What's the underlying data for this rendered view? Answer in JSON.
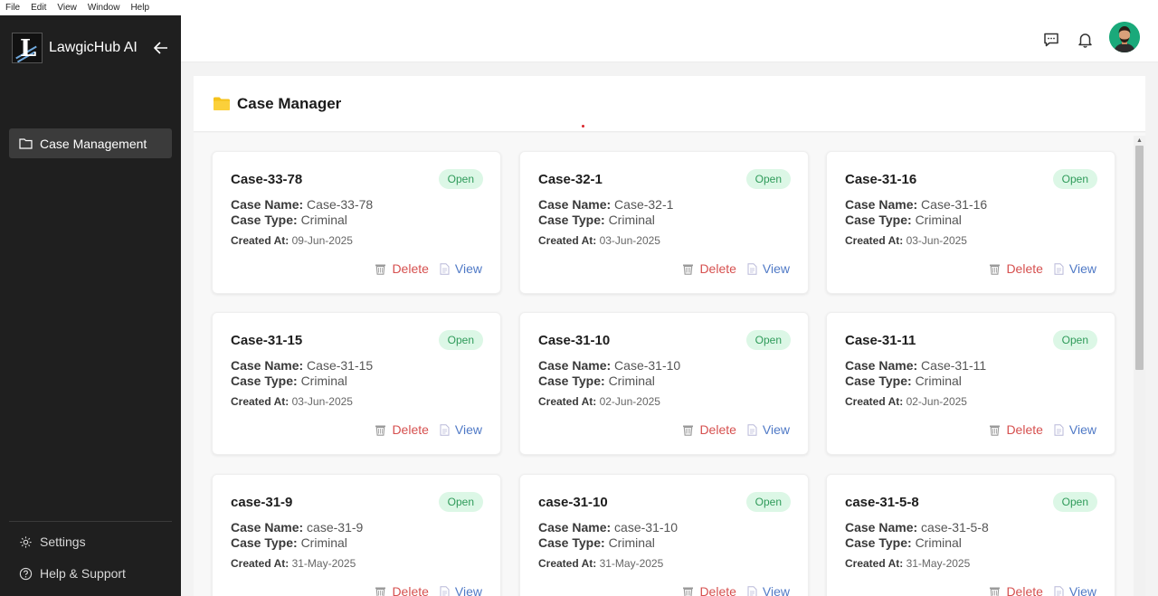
{
  "menubar": [
    "File",
    "Edit",
    "View",
    "Window",
    "Help"
  ],
  "brand": {
    "name": "LawgicHub AI",
    "logo_letter": "L"
  },
  "sidebar": {
    "nav_item": "Case Management",
    "footer": {
      "settings": "Settings",
      "help": "Help & Support"
    }
  },
  "page": {
    "title": "Case Manager"
  },
  "labels": {
    "case_name": "Case Name:",
    "case_type": "Case Type:",
    "created_at": "Created At:",
    "delete": "Delete",
    "view": "View"
  },
  "colors": {
    "sidebar_bg": "#1f1f1f",
    "badge_bg": "#dcf7e6",
    "badge_text": "#2f9b5a",
    "delete": "#d6504f",
    "view": "#4f79c6",
    "folder": "#f5c21b"
  },
  "cases": [
    {
      "code": "Case-33-78",
      "status": "Open",
      "name": "Case-33-78",
      "type": "Criminal",
      "created": "09-Jun-2025"
    },
    {
      "code": "Case-32-1",
      "status": "Open",
      "name": "Case-32-1",
      "type": "Criminal",
      "created": "03-Jun-2025"
    },
    {
      "code": "Case-31-16",
      "status": "Open",
      "name": "Case-31-16",
      "type": "Criminal",
      "created": "03-Jun-2025"
    },
    {
      "code": "Case-31-15",
      "status": "Open",
      "name": "Case-31-15",
      "type": "Criminal",
      "created": "03-Jun-2025"
    },
    {
      "code": "Case-31-10",
      "status": "Open",
      "name": "Case-31-10",
      "type": "Criminal",
      "created": "02-Jun-2025"
    },
    {
      "code": "Case-31-11",
      "status": "Open",
      "name": "Case-31-11",
      "type": "Criminal",
      "created": "02-Jun-2025"
    },
    {
      "code": "case-31-9",
      "status": "Open",
      "name": "case-31-9",
      "type": "Criminal",
      "created": "31-May-2025"
    },
    {
      "code": "case-31-10",
      "status": "Open",
      "name": "case-31-10",
      "type": "Criminal",
      "created": "31-May-2025"
    },
    {
      "code": "case-31-5-8",
      "status": "Open",
      "name": "case-31-5-8",
      "type": "Criminal",
      "created": "31-May-2025"
    }
  ]
}
